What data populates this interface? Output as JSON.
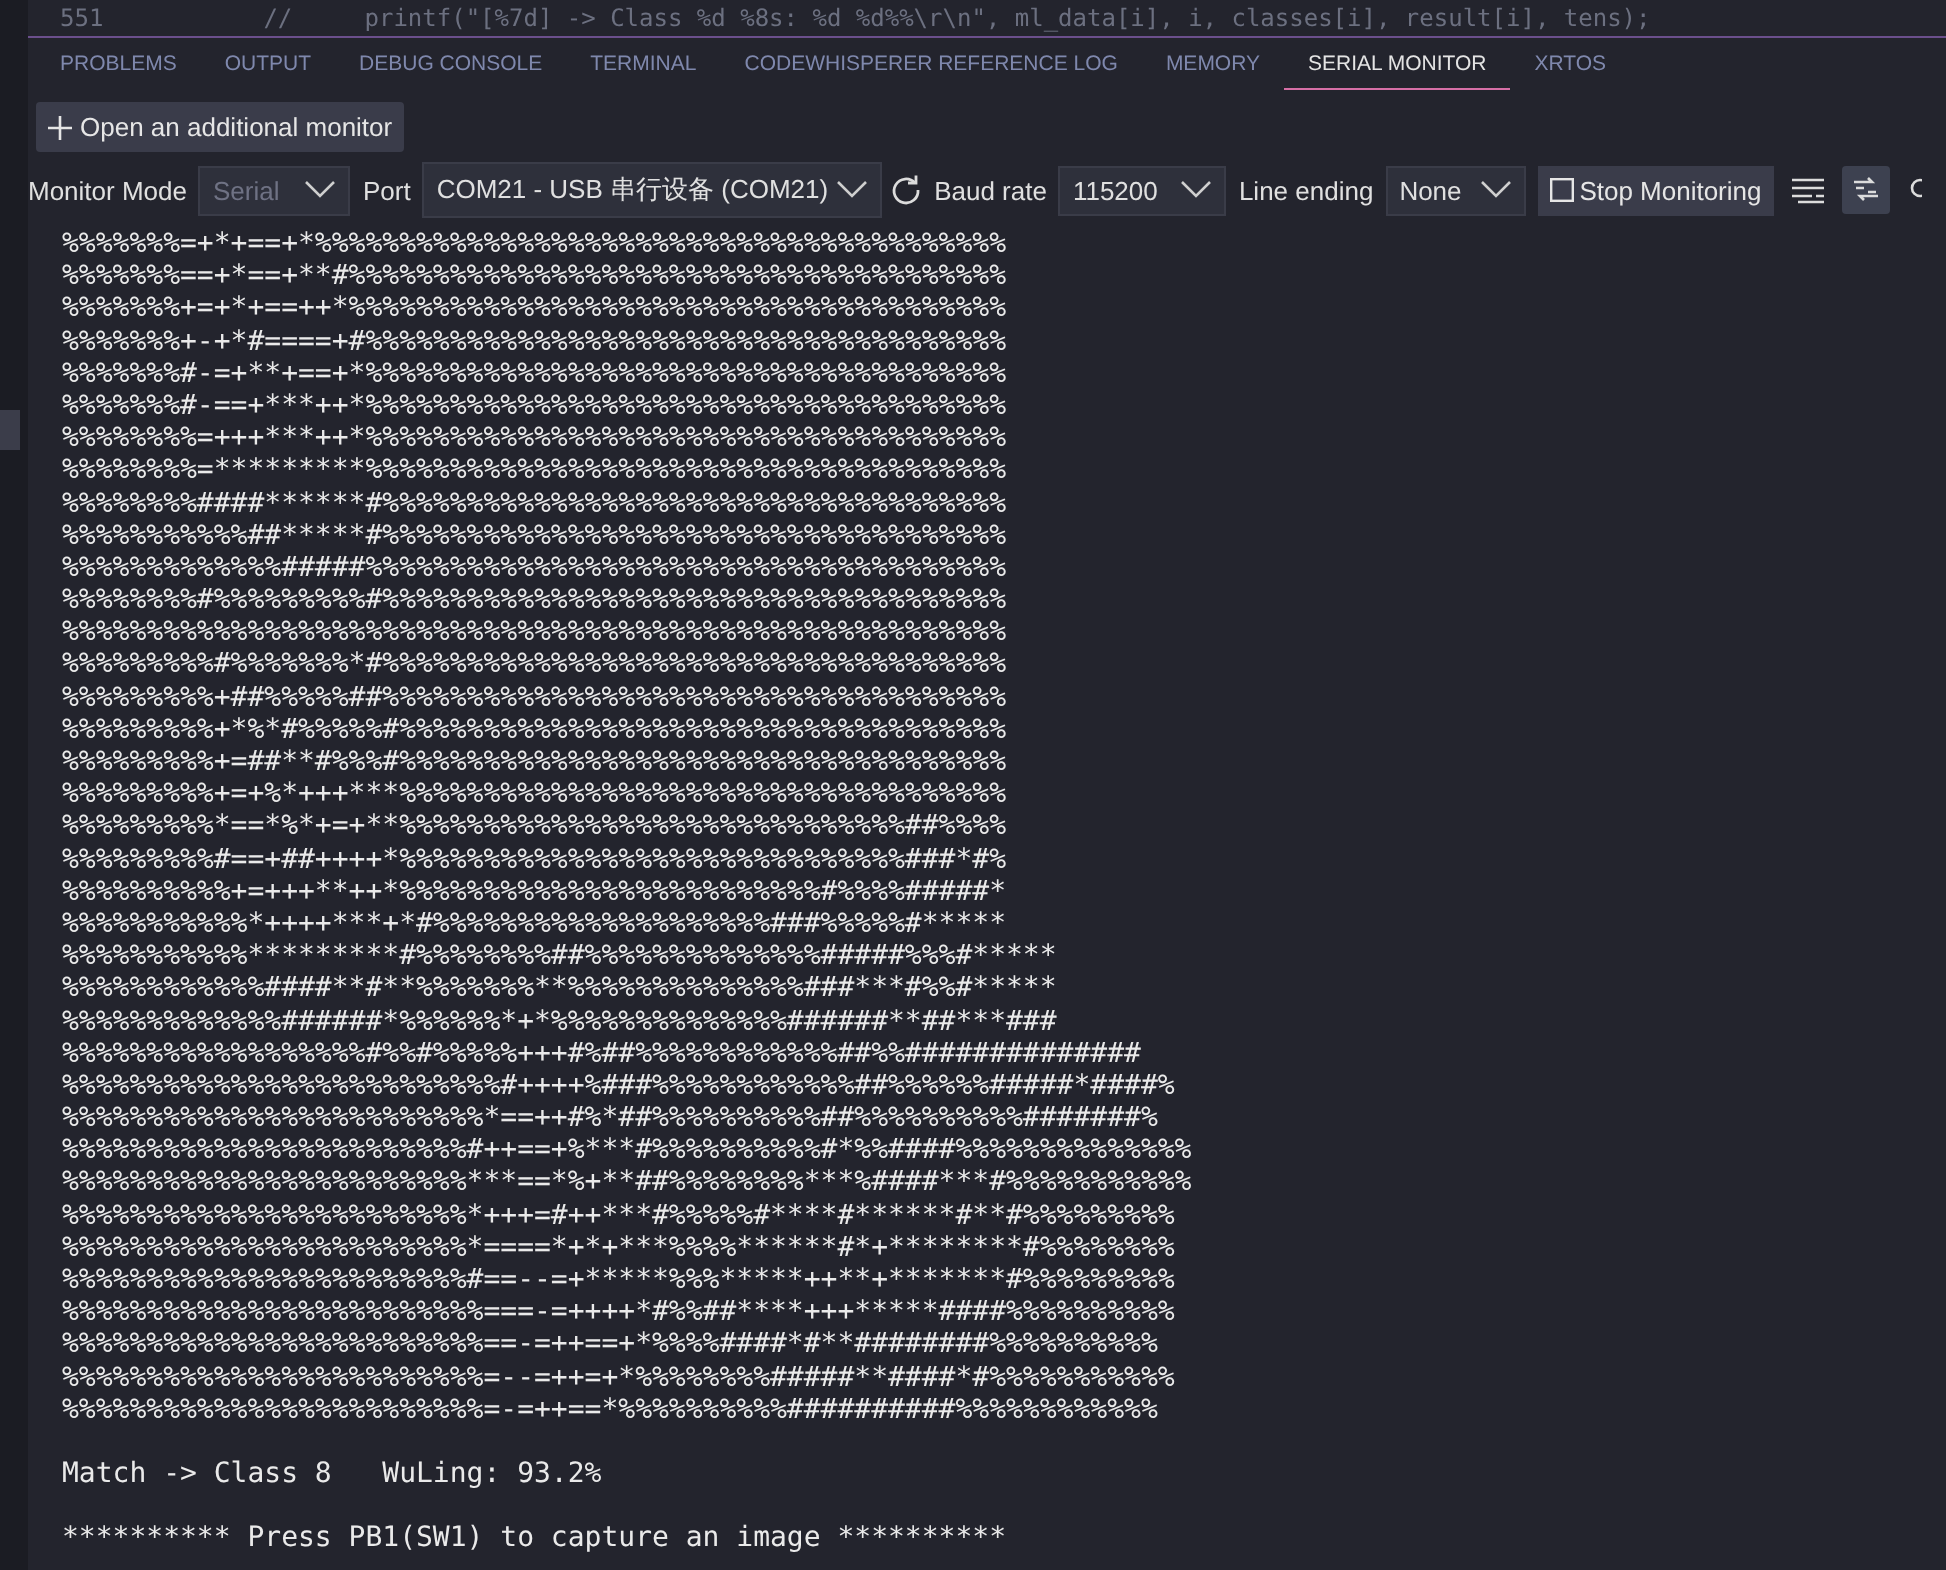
{
  "editor_line": {
    "number": "551",
    "code": "//     printf(\"[%7d] -> Class %d %8s: %d %d%%\\r\\n\", ml_data[i], i, classes[i], result[i], tens);"
  },
  "tabs": [
    {
      "label": "PROBLEMS",
      "selected": false
    },
    {
      "label": "OUTPUT",
      "selected": false
    },
    {
      "label": "DEBUG CONSOLE",
      "selected": false
    },
    {
      "label": "TERMINAL",
      "selected": false
    },
    {
      "label": "CODEWHISPERER REFERENCE LOG",
      "selected": false
    },
    {
      "label": "MEMORY",
      "selected": false
    },
    {
      "label": "SERIAL MONITOR",
      "selected": true
    },
    {
      "label": "XRTOS",
      "selected": false
    }
  ],
  "add_monitor_button": {
    "label": "Open an additional monitor"
  },
  "toolbar": {
    "monitor_mode": {
      "label": "Monitor Mode",
      "value": "Serial",
      "disabled": true
    },
    "port": {
      "label": "Port",
      "value": "COM21 - USB 串行设备 (COM21)"
    },
    "baud_rate": {
      "label": "Baud rate",
      "value": "115200"
    },
    "line_ending": {
      "label": "Line ending",
      "value": "None"
    },
    "stop_button": {
      "label": "Stop Monitoring"
    },
    "toggle_on": true
  },
  "output_lines": [
    "%%%%%%%=+*+==+*%%%%%%%%%%%%%%%%%%%%%%%%%%%%%%%%%%%%%%%%%",
    "%%%%%%%==+*==+**#%%%%%%%%%%%%%%%%%%%%%%%%%%%%%%%%%%%%%%%",
    "%%%%%%%+=+*+==++*%%%%%%%%%%%%%%%%%%%%%%%%%%%%%%%%%%%%%%%",
    "%%%%%%%+-+*#====+#%%%%%%%%%%%%%%%%%%%%%%%%%%%%%%%%%%%%%%",
    "%%%%%%%#-=+**+==+*%%%%%%%%%%%%%%%%%%%%%%%%%%%%%%%%%%%%%%",
    "%%%%%%%#-==+***++*%%%%%%%%%%%%%%%%%%%%%%%%%%%%%%%%%%%%%%",
    "%%%%%%%%=+++***++*%%%%%%%%%%%%%%%%%%%%%%%%%%%%%%%%%%%%%%",
    "%%%%%%%%=*********%%%%%%%%%%%%%%%%%%%%%%%%%%%%%%%%%%%%%%",
    "%%%%%%%%####******#%%%%%%%%%%%%%%%%%%%%%%%%%%%%%%%%%%%%%",
    "%%%%%%%%%%%##*****#%%%%%%%%%%%%%%%%%%%%%%%%%%%%%%%%%%%%%",
    "%%%%%%%%%%%%%#####%%%%%%%%%%%%%%%%%%%%%%%%%%%%%%%%%%%%%%",
    "%%%%%%%%#%%%%%%%%%#%%%%%%%%%%%%%%%%%%%%%%%%%%%%%%%%%%%%%",
    "%%%%%%%%%%%%%%%%%%%%%%%%%%%%%%%%%%%%%%%%%%%%%%%%%%%%%%%%",
    "%%%%%%%%%#%%%%%%%*#%%%%%%%%%%%%%%%%%%%%%%%%%%%%%%%%%%%%%",
    "%%%%%%%%%+##%%%%%##%%%%%%%%%%%%%%%%%%%%%%%%%%%%%%%%%%%%%",
    "%%%%%%%%%+*%*#%%%%%#%%%%%%%%%%%%%%%%%%%%%%%%%%%%%%%%%%%%",
    "%%%%%%%%%+=##**#%%%#%%%%%%%%%%%%%%%%%%%%%%%%%%%%%%%%%%%%",
    "%%%%%%%%%+=+%*+++***%%%%%%%%%%%%%%%%%%%%%%%%%%%%%%%%%%%%",
    "%%%%%%%%%*==*%*+=+**%%%%%%%%%%%%%%%%%%%%%%%%%%%%%%##%%%%",
    "%%%%%%%%%#==+##++++*%%%%%%%%%%%%%%%%%%%%%%%%%%%%%%###*#%",
    "%%%%%%%%%%+=+++**++*%%%%%%%%%%%%%%%%%%%%%%%%%#%%%%#####*",
    "%%%%%%%%%%%*++++***+*#%%%%%%%%%%%%%%%%%%%%###%%%%%#*****",
    "%%%%%%%%%%%*********#%%%%%%%%##%%%%%%%%%%%%%%#####%%%#*****",
    "%%%%%%%%%%%%####**#**%%%%%%%**%%%%%%%%%%%%%%###***#%%#*****",
    "%%%%%%%%%%%%%######*%%%%%%*+*%%%%%%%%%%%%%%######**##***###",
    "%%%%%%%%%%%%%%%%%%#%%#%%%%%+++#%##%%%%%%%%%%%%##%%##############",
    "%%%%%%%%%%%%%%%%%%%%%%%%%%#++++%###%%%%%%%%%%%%##%%%%%%#####*####%",
    "%%%%%%%%%%%%%%%%%%%%%%%%%*==++#%*##%%%%%%%%%%##%%%%%%%%%%#######%",
    "%%%%%%%%%%%%%%%%%%%%%%%%#++==+%***#%%%%%%%%%%#*%%####%%%%%%%%%%%%%%",
    "%%%%%%%%%%%%%%%%%%%%%%%%***==*%+**##%%%%%%%%***%####***#%%%%%%%%%%%",
    "%%%%%%%%%%%%%%%%%%%%%%%%*+++=#++***#%%%%%#****#******#**#%%%%%%%%%",
    "%%%%%%%%%%%%%%%%%%%%%%%%*====*+*+***%%%%******#*+********#%%%%%%%%",
    "%%%%%%%%%%%%%%%%%%%%%%%%#==--=+*****%%%*****++**+*******#%%%%%%%%%",
    "%%%%%%%%%%%%%%%%%%%%%%%%%===-=++++*#%%##****+++*****####%%%%%%%%%%",
    "%%%%%%%%%%%%%%%%%%%%%%%%%==-=++==+*%%%%####*#**########%%%%%%%%%%",
    "%%%%%%%%%%%%%%%%%%%%%%%%%=--=++=+*%%%%%%%%#####**####*#%%%%%%%%%%%",
    "%%%%%%%%%%%%%%%%%%%%%%%%%=-=++==*%%%%%%%%%%##########%%%%%%%%%%%%"
  ],
  "result_line": "Match -> Class 8   WuLing: 93.2%",
  "prompt_line": "********** Press PB1(SW1) to capture an image **********"
}
